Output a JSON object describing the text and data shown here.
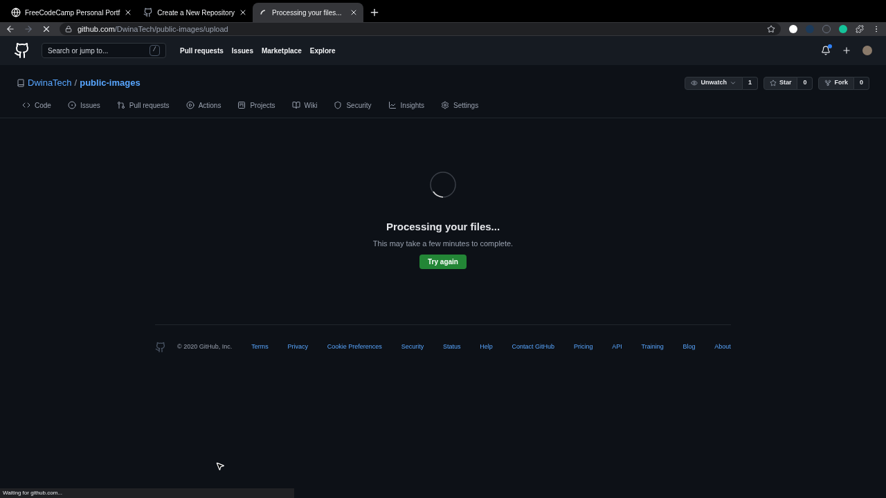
{
  "browser_tabs": [
    {
      "title": "FreeCodeCamp Personal Portf",
      "selected": false,
      "kind": "site"
    },
    {
      "title": "Create a New Repository",
      "selected": false,
      "kind": "github"
    },
    {
      "title": "Processing your files...",
      "selected": true,
      "kind": "loading"
    }
  ],
  "address": {
    "host": "github.com",
    "path": "/DwinaTech/public-images/upload"
  },
  "header": {
    "search_placeholder": "Search or jump to...",
    "slash_key": "/",
    "nav": [
      "Pull requests",
      "Issues",
      "Marketplace",
      "Explore"
    ]
  },
  "repo": {
    "owner": "DwinaTech",
    "separator": "/",
    "name": "public-images",
    "actions": [
      {
        "label": "Unwatch",
        "count": "1",
        "kind": "watch"
      },
      {
        "label": "Star",
        "count": "0",
        "kind": "star"
      },
      {
        "label": "Fork",
        "count": "0",
        "kind": "fork"
      }
    ],
    "tabs": [
      {
        "label": "Code",
        "kind": "code"
      },
      {
        "label": "Issues",
        "kind": "issues"
      },
      {
        "label": "Pull requests",
        "kind": "pulls"
      },
      {
        "label": "Actions",
        "kind": "actions"
      },
      {
        "label": "Projects",
        "kind": "projects"
      },
      {
        "label": "Wiki",
        "kind": "wiki"
      },
      {
        "label": "Security",
        "kind": "security"
      },
      {
        "label": "Insights",
        "kind": "insights"
      },
      {
        "label": "Settings",
        "kind": "settings"
      }
    ]
  },
  "processing": {
    "title": "Processing your files...",
    "message": "This may take a few minutes to complete.",
    "button": "Try again"
  },
  "footer": {
    "copyright": "© 2020 GitHub, Inc.",
    "links": [
      "Terms",
      "Privacy",
      "Cookie Preferences",
      "Security",
      "Status",
      "Help",
      "Contact GitHub",
      "Pricing",
      "API",
      "Training",
      "Blog",
      "About"
    ]
  },
  "status_bar": "Waiting for github.com..."
}
